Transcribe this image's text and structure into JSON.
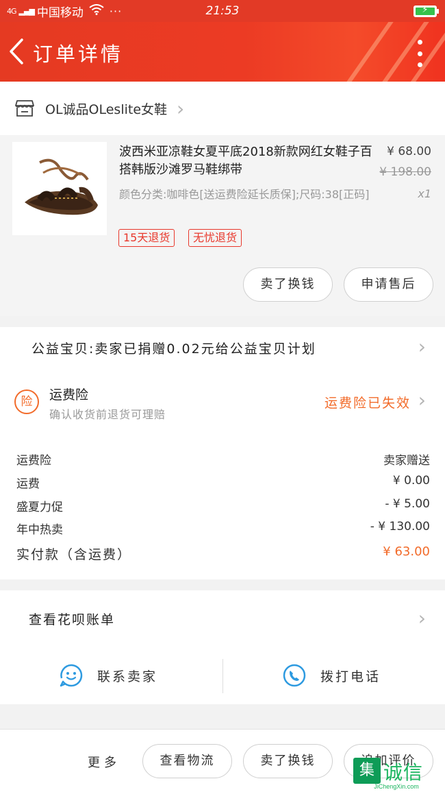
{
  "status_bar": {
    "signal": "4G",
    "carrier": "中国移动",
    "dots": "···",
    "time": "21:53",
    "battery_icon": "battery-charging-icon",
    "wifi_icon": "wifi-icon"
  },
  "header": {
    "title": "订单详情",
    "back_icon": "back-arrow-icon",
    "more_icon": "more-vertical-icon",
    "background": "#e53a22"
  },
  "shop": {
    "name": "OL诚品OLeslite女鞋",
    "icon": "store-icon"
  },
  "item": {
    "title": "波西米亚凉鞋女夏平底2018新款网红女鞋子百搭韩版沙滩罗马鞋绑带",
    "price": "¥ 68.00",
    "original_price": "¥ 198.00",
    "spec": "颜色分类:咖啡色[送运费险延长质保];尺码:38[正码]",
    "quantity": "x1",
    "tags": [
      "15天退货",
      "无忧退货"
    ],
    "buttons": [
      "卖了换钱",
      "申请售后"
    ]
  },
  "charity": {
    "text": "公益宝贝:卖家已捐赠0.02元给公益宝贝计划"
  },
  "insurance": {
    "icon_text": "险",
    "title": "运费险",
    "subtitle": "确认收货前退货可理赔",
    "status": "运费险已失效",
    "accent": "#f26b2a"
  },
  "fees": [
    {
      "label": "运费险",
      "value": "卖家赠送"
    },
    {
      "label": "运费",
      "value": "¥ 0.00"
    },
    {
      "label": "盛夏力促",
      "value": "- ¥ 5.00"
    },
    {
      "label": "年中热卖",
      "value": "- ¥ 130.00"
    }
  ],
  "total": {
    "label": "实付款（含运费）",
    "value": "¥ 63.00"
  },
  "huabei": {
    "text": "查看花呗账单"
  },
  "contact": {
    "seller": "联系卖家",
    "seller_icon": "chat-face-icon",
    "phone": "拨打电话",
    "phone_icon": "phone-icon"
  },
  "bottom_bar": {
    "more": "更多",
    "buttons": [
      "查看物流",
      "卖了换钱",
      "追加评价"
    ]
  },
  "watermark": {
    "box": "集",
    "main": "诚信",
    "sub": "JiChengXin.com"
  }
}
